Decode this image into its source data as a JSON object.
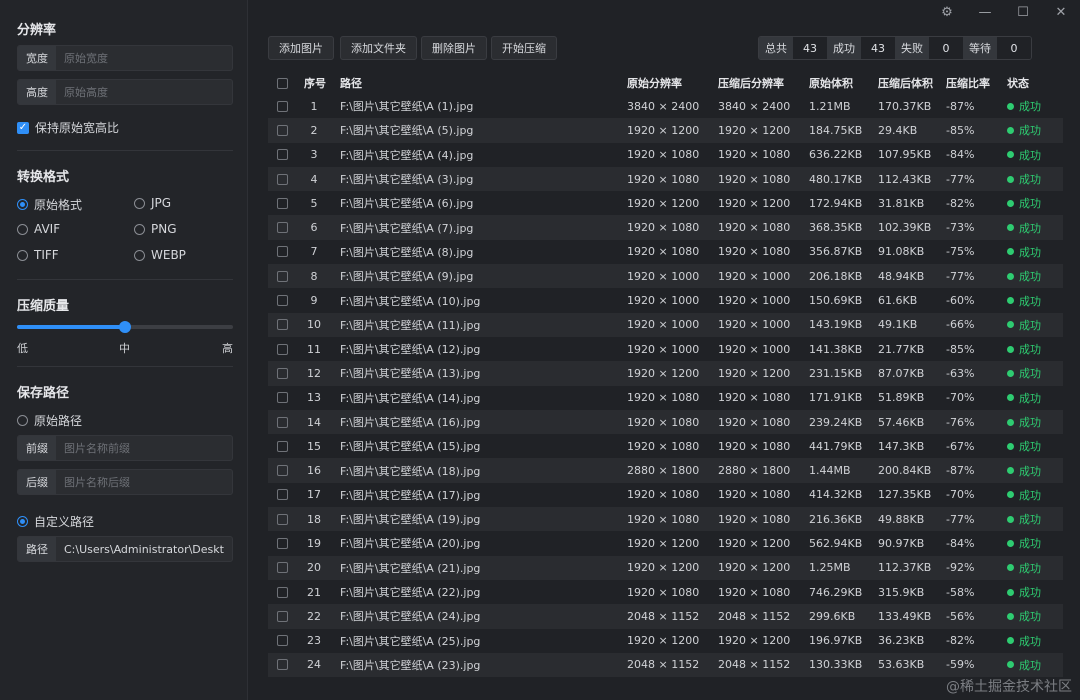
{
  "sidebar": {
    "resolution": {
      "title": "分辨率",
      "width_label": "宽度",
      "width_placeholder": "原始宽度",
      "height_label": "高度",
      "height_placeholder": "原始高度",
      "keep_ratio": "保持原始宽高比"
    },
    "format": {
      "title": "转换格式",
      "options": [
        "原始格式",
        "JPG",
        "AVIF",
        "PNG",
        "TIFF",
        "WEBP"
      ],
      "selected": "原始格式"
    },
    "quality": {
      "title": "压缩质量",
      "low": "低",
      "mid": "中",
      "high": "高",
      "level": 0.5
    },
    "save": {
      "title": "保存路径",
      "original_path": "原始路径",
      "prefix_label": "前缀",
      "prefix_placeholder": "图片名称前缀",
      "suffix_label": "后缀",
      "suffix_placeholder": "图片名称后缀",
      "custom_path": "自定义路径",
      "path_label": "路径",
      "path_value": "C:\\Users\\Administrator\\Desktop\\"
    }
  },
  "toolbar": {
    "add_image": "添加图片",
    "add_folder": "添加文件夹",
    "delete_image": "删除图片",
    "start": "开始压缩"
  },
  "stats": {
    "total_label": "总共",
    "total": "43",
    "success_label": "成功",
    "success": "43",
    "fail_label": "失败",
    "fail": "0",
    "wait_label": "等待",
    "wait": "0"
  },
  "table": {
    "headers": [
      "序号",
      "路径",
      "原始分辨率",
      "压缩后分辨率",
      "原始体积",
      "压缩后体积",
      "压缩比率",
      "状态"
    ],
    "rows": [
      [
        "1",
        "F:\\图片\\其它壁纸\\A (1).jpg",
        "3840 × 2400",
        "3840 × 2400",
        "1.21MB",
        "170.37KB",
        "-87%",
        "成功"
      ],
      [
        "2",
        "F:\\图片\\其它壁纸\\A (5).jpg",
        "1920 × 1200",
        "1920 × 1200",
        "184.75KB",
        "29.4KB",
        "-85%",
        "成功"
      ],
      [
        "3",
        "F:\\图片\\其它壁纸\\A (4).jpg",
        "1920 × 1080",
        "1920 × 1080",
        "636.22KB",
        "107.95KB",
        "-84%",
        "成功"
      ],
      [
        "4",
        "F:\\图片\\其它壁纸\\A (3).jpg",
        "1920 × 1080",
        "1920 × 1080",
        "480.17KB",
        "112.43KB",
        "-77%",
        "成功"
      ],
      [
        "5",
        "F:\\图片\\其它壁纸\\A (6).jpg",
        "1920 × 1200",
        "1920 × 1200",
        "172.94KB",
        "31.81KB",
        "-82%",
        "成功"
      ],
      [
        "6",
        "F:\\图片\\其它壁纸\\A (7).jpg",
        "1920 × 1080",
        "1920 × 1080",
        "368.35KB",
        "102.39KB",
        "-73%",
        "成功"
      ],
      [
        "7",
        "F:\\图片\\其它壁纸\\A (8).jpg",
        "1920 × 1080",
        "1920 × 1080",
        "356.87KB",
        "91.08KB",
        "-75%",
        "成功"
      ],
      [
        "8",
        "F:\\图片\\其它壁纸\\A (9).jpg",
        "1920 × 1000",
        "1920 × 1000",
        "206.18KB",
        "48.94KB",
        "-77%",
        "成功"
      ],
      [
        "9",
        "F:\\图片\\其它壁纸\\A (10).jpg",
        "1920 × 1000",
        "1920 × 1000",
        "150.69KB",
        "61.6KB",
        "-60%",
        "成功"
      ],
      [
        "10",
        "F:\\图片\\其它壁纸\\A (11).jpg",
        "1920 × 1000",
        "1920 × 1000",
        "143.19KB",
        "49.1KB",
        "-66%",
        "成功"
      ],
      [
        "11",
        "F:\\图片\\其它壁纸\\A (12).jpg",
        "1920 × 1000",
        "1920 × 1000",
        "141.38KB",
        "21.77KB",
        "-85%",
        "成功"
      ],
      [
        "12",
        "F:\\图片\\其它壁纸\\A (13).jpg",
        "1920 × 1200",
        "1920 × 1200",
        "231.15KB",
        "87.07KB",
        "-63%",
        "成功"
      ],
      [
        "13",
        "F:\\图片\\其它壁纸\\A (14).jpg",
        "1920 × 1080",
        "1920 × 1080",
        "171.91KB",
        "51.89KB",
        "-70%",
        "成功"
      ],
      [
        "14",
        "F:\\图片\\其它壁纸\\A (16).jpg",
        "1920 × 1080",
        "1920 × 1080",
        "239.24KB",
        "57.46KB",
        "-76%",
        "成功"
      ],
      [
        "15",
        "F:\\图片\\其它壁纸\\A (15).jpg",
        "1920 × 1080",
        "1920 × 1080",
        "441.79KB",
        "147.3KB",
        "-67%",
        "成功"
      ],
      [
        "16",
        "F:\\图片\\其它壁纸\\A (18).jpg",
        "2880 × 1800",
        "2880 × 1800",
        "1.44MB",
        "200.84KB",
        "-87%",
        "成功"
      ],
      [
        "17",
        "F:\\图片\\其它壁纸\\A (17).jpg",
        "1920 × 1080",
        "1920 × 1080",
        "414.32KB",
        "127.35KB",
        "-70%",
        "成功"
      ],
      [
        "18",
        "F:\\图片\\其它壁纸\\A (19).jpg",
        "1920 × 1080",
        "1920 × 1080",
        "216.36KB",
        "49.88KB",
        "-77%",
        "成功"
      ],
      [
        "19",
        "F:\\图片\\其它壁纸\\A (20).jpg",
        "1920 × 1200",
        "1920 × 1200",
        "562.94KB",
        "90.97KB",
        "-84%",
        "成功"
      ],
      [
        "20",
        "F:\\图片\\其它壁纸\\A (21).jpg",
        "1920 × 1200",
        "1920 × 1200",
        "1.25MB",
        "112.37KB",
        "-92%",
        "成功"
      ],
      [
        "21",
        "F:\\图片\\其它壁纸\\A (22).jpg",
        "1920 × 1080",
        "1920 × 1080",
        "746.29KB",
        "315.9KB",
        "-58%",
        "成功"
      ],
      [
        "22",
        "F:\\图片\\其它壁纸\\A (24).jpg",
        "2048 × 1152",
        "2048 × 1152",
        "299.6KB",
        "133.49KB",
        "-56%",
        "成功"
      ],
      [
        "23",
        "F:\\图片\\其它壁纸\\A (25).jpg",
        "1920 × 1200",
        "1920 × 1200",
        "196.97KB",
        "36.23KB",
        "-82%",
        "成功"
      ],
      [
        "24",
        "F:\\图片\\其它壁纸\\A (23).jpg",
        "2048 × 1152",
        "2048 × 1152",
        "130.33KB",
        "53.63KB",
        "-59%",
        "成功"
      ]
    ]
  },
  "watermark": "@稀土掘金技术社区",
  "colors": {
    "accent": "#2f8ff7",
    "success": "#2ecc71",
    "bg": "#202226",
    "sidebar": "#232529"
  },
  "icons": {
    "settings": "gear-icon",
    "minimize": "minimize-icon",
    "maximize": "maximize-icon",
    "close": "close-icon"
  }
}
